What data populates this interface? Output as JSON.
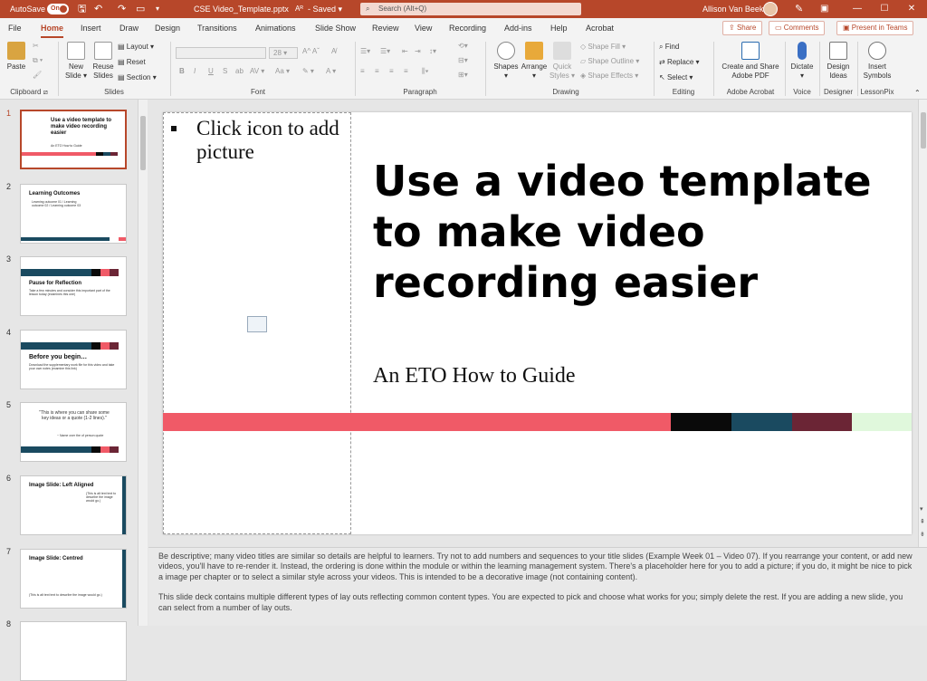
{
  "titlebar": {
    "autosave_label": "AutoSave",
    "autosave_state": "On",
    "doc_title": "CSE Video_Template.pptx",
    "saved_state": "Saved",
    "search_placeholder": "Search (Alt+Q)",
    "user_name": "Allison Van Beek"
  },
  "tabs": [
    "File",
    "Home",
    "Insert",
    "Draw",
    "Design",
    "Transitions",
    "Animations",
    "Slide Show",
    "Review",
    "View",
    "Recording",
    "Add-ins",
    "Help",
    "Acrobat"
  ],
  "tab_actions": {
    "share": "Share",
    "comments": "Comments",
    "present": "Present in Teams"
  },
  "ribbon": {
    "clipboard": {
      "paste": "Paste",
      "group": "Clipboard"
    },
    "slides": {
      "new_slide_1": "New",
      "new_slide_2": "Slide",
      "reuse_1": "Reuse",
      "reuse_2": "Slides",
      "layout": "Layout",
      "reset": "Reset",
      "section": "Section",
      "group": "Slides"
    },
    "font": {
      "size": "28",
      "group": "Font",
      "bold": "B",
      "italic": "I",
      "underline": "U",
      "strike": "S"
    },
    "paragraph": {
      "group": "Paragraph"
    },
    "drawing": {
      "shapes": "Shapes",
      "arrange": "Arrange",
      "quick_styles_1": "Quick",
      "quick_styles_2": "Styles",
      "shape_fill": "Shape Fill",
      "shape_outline": "Shape Outline",
      "shape_effects": "Shape Effects",
      "group": "Drawing"
    },
    "editing": {
      "find": "Find",
      "replace": "Replace",
      "select": "Select",
      "group": "Editing"
    },
    "acrobat": {
      "create_1": "Create and Share",
      "create_2": "Adobe PDF",
      "group": "Adobe Acrobat"
    },
    "voice": {
      "dictate": "Dictate",
      "group": "Voice"
    },
    "designer": {
      "design_1": "Design",
      "design_2": "Ideas",
      "group": "Designer"
    },
    "lessonpix": {
      "insert_1": "Insert",
      "insert_2": "Symbols",
      "group": "LessonPix"
    }
  },
  "thumbnails": [
    {
      "num": "1",
      "title": "Use a video template to make video recording easier",
      "sub": "An ETO How to Guide"
    },
    {
      "num": "2",
      "title": "Learning Outcomes",
      "sub": "Learning outcome 01 / Learning outcome 02 / Learning outcome 03"
    },
    {
      "num": "3",
      "title": "Pause for Reflection",
      "sub": "Take a few minutes and consider this important part of the lesson today (examines this one)"
    },
    {
      "num": "4",
      "title": "Before you begin…",
      "sub": "Download the supplementary work file for this video and take your own notes (examine this link)"
    },
    {
      "num": "5",
      "title": "\"This is where you can share some key ideas or a quote (1-2 lines).\"",
      "sub": "~ Name over the of person quote"
    },
    {
      "num": "6",
      "title": "Image Slide: Left Aligned",
      "sub": "(This is alt text text to describe the image would go.)"
    },
    {
      "num": "7",
      "title": "Image Slide: Centred",
      "sub": "(This is alt text text to describe the image would go.)"
    },
    {
      "num": "8",
      "title": "",
      "sub": ""
    }
  ],
  "slide": {
    "placeholder_text": "Click icon to add picture",
    "title": "Use a video template to make video recording easier",
    "subtitle": "An ETO How to Guide"
  },
  "colors": {
    "accent": "#b7472a",
    "bar_red": "#f05a67",
    "bar_black": "#0a0a0a",
    "bar_teal": "#1a4a60",
    "bar_maroon": "#6b2535",
    "bar_mint": "#e0f8dc"
  },
  "notes": [
    "Be descriptive; many video titles are similar so details are helpful to learners. Try not to add numbers and sequences to your title slides (Example Week 01 – Video 07). If you rearrange your content, or add new videos, you'll have to re-render it. Instead, the ordering is done within the module or within the learning management system. There's a placeholder here for you to add a picture; if you do, it might be nice to pick a image per chapter or to select a similar style across your videos. This is intended to be a decorative image (not containing content).",
    "This slide deck contains multiple different types of lay outs reflecting common content types. You are expected to pick and choose what works for you; simply delete the rest. If you are adding a new slide, you can select from a number of lay outs."
  ]
}
